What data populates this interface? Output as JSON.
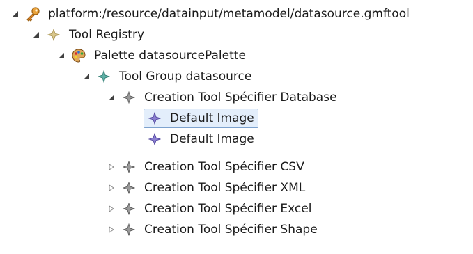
{
  "tree": {
    "root": {
      "label": "platform:/resource/datainput/metamodel/datasource.gmftool",
      "icon": "key-icon",
      "expanded": true
    },
    "tool_registry": {
      "label": "Tool Registry",
      "icon": "diamond-tan-icon",
      "expanded": true
    },
    "palette": {
      "label": "Palette datasourcePalette",
      "icon": "palette-icon",
      "expanded": true
    },
    "tool_group": {
      "label": "Tool Group datasource",
      "icon": "diamond-teal-icon",
      "expanded": true
    },
    "creation_tools": [
      {
        "label": "Creation Tool Spécifier Database",
        "icon": "diamond-gray-icon",
        "expanded": true,
        "children": [
          {
            "label": "Default Image",
            "icon": "diamond-purple-icon",
            "selected": true
          },
          {
            "label": "Default Image",
            "icon": "diamond-purple-icon",
            "selected": false
          }
        ]
      },
      {
        "label": "Creation Tool Spécifier CSV",
        "icon": "diamond-gray-icon",
        "expanded": false
      },
      {
        "label": "Creation Tool Spécifier XML",
        "icon": "diamond-gray-icon",
        "expanded": false
      },
      {
        "label": "Creation Tool Spécifier Excel",
        "icon": "diamond-gray-icon",
        "expanded": false
      },
      {
        "label": "Creation Tool Spécifier Shape",
        "icon": "diamond-gray-icon",
        "expanded": false
      }
    ]
  },
  "colors": {
    "selection_border": "#7da2ce",
    "selection_fill": "#e3eefb",
    "twisty": "#404040"
  }
}
